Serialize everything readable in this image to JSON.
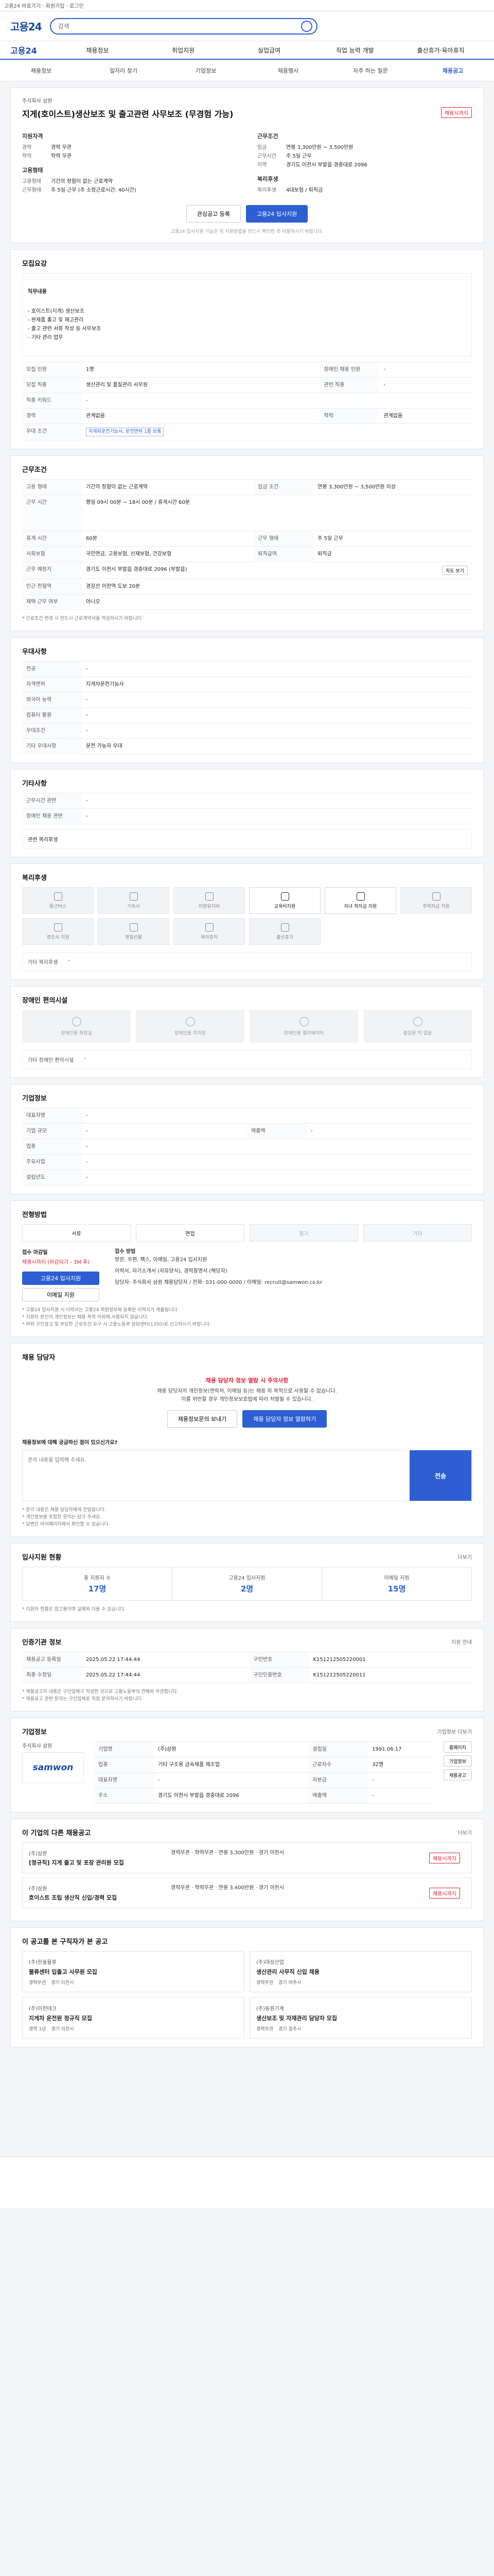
{
  "topbar": {
    "text": "고용24 바로가기 · 회원가입 · 로그인"
  },
  "header": {
    "logo": "고용24",
    "search_placeholder": "검색"
  },
  "gnb": {
    "logo": "고용24",
    "items": [
      "채용정보",
      "취업지원",
      "실업급여",
      "직업 능력 개발",
      "출산휴가·육아휴직"
    ]
  },
  "crumbs": [
    "채용정보",
    "일자리 찾기",
    "기업정보",
    "채용행사",
    "자주 하는 질문",
    "채용공고"
  ],
  "job": {
    "company": "주식회사 삼원",
    "title": "지게(호이스트)생산보조 및 출고관련 사무보조 (무경험 가능)",
    "badge": "채용시까지",
    "recruit_title": "지원자격",
    "career": "경력 무관",
    "education": "학력 무관",
    "cond_title": "근무조건",
    "pay": "연봉 3,300만원 ~ 3,500만원",
    "hours": "주 5일 근무",
    "location": "경기도 이천시 부발읍 경충대로 2096",
    "emp_title": "고용형태",
    "emp_type": "기간의 정함이 없는 근로계약",
    "work_type": "주 5일 근무 (주 소정근로시간: 40시간)",
    "welfare_title": "복리후생",
    "welfare_val": "4대보험 / 퇴직금",
    "btn_scrap": "관심공고 등록",
    "btn_apply": "고용24 입사지원",
    "notice": "고용24 입사지원 기능은 위 지원방법을 반드시 확인한 후 이용하시기 바랍니다."
  },
  "recruit": {
    "title": "모집요강",
    "duty_label": "직무내용",
    "duties": "- 호이스트(지게) 생산보조\n- 완제품 출고 및 재고관리\n- 출고 관련 서류 작성 등 사무보조\n- 기타 관리 업무",
    "rows": [
      {
        "k": "모집 인원",
        "v": "1명",
        "k2": "장애인 채용 인원",
        "v2": "-"
      },
      {
        "k": "모집 직종",
        "v": "생산관리 및 품질관리 사무원",
        "k2": "관련 직종",
        "v2": "-"
      },
      {
        "k": "직종 키워드",
        "v": "-",
        "k2": "",
        "v2": ""
      },
      {
        "k": "경력",
        "v": "관계없음",
        "k2": "학력",
        "v2": "관계없음"
      },
      {
        "k": "우대 조건",
        "v": "지게차운전기능사, 운전면허 1종 보통",
        "k2": "",
        "v2": ""
      }
    ]
  },
  "conditions": {
    "title": "근무조건",
    "rows": [
      {
        "k": "고용 형태",
        "v": "기간의 정함이 없는 근로계약",
        "k2": "임금 조건",
        "v2": "연봉 3,300만원 ~ 3,500만원 이상"
      },
      {
        "k": "근무 시간",
        "v": "평일 09시 00분 ~ 18시 00분 / 휴게시간 60분",
        "k2": "",
        "v2": ""
      },
      {
        "k": "휴게 시간",
        "v": "60분",
        "k2": "근무 형태",
        "v2": "주 5일 근무"
      },
      {
        "k": "사회보험",
        "v": "국민연금, 고용보험, 산재보험, 건강보험",
        "k2": "퇴직급여",
        "v2": "퇴직금"
      },
      {
        "k": "근무 예정지",
        "v": "경기도 이천시 부발읍 경충대로 2096 (부발읍)",
        "k2": "",
        "v2": ""
      },
      {
        "k": "인근 전철역",
        "v": "경강선 이천역 도보 20분",
        "k2": "",
        "v2": ""
      },
      {
        "k": "재택 근무 여부",
        "v": "아니오",
        "k2": "",
        "v2": ""
      }
    ],
    "map_btn": "지도 보기",
    "note": "* 근로조건 변경 시 반드시 근로계약서를 작성하시기 바랍니다."
  },
  "prefs": {
    "title": "우대사항",
    "rows": [
      {
        "k": "전공",
        "v": "-"
      },
      {
        "k": "자격면허",
        "v": "지게차운전기능사"
      },
      {
        "k": "외국어 능력",
        "v": "-"
      },
      {
        "k": "컴퓨터 활용",
        "v": "-"
      },
      {
        "k": "우대조건",
        "v": "-"
      },
      {
        "k": "기타 우대사항",
        "v": "운전 가능자 우대"
      }
    ]
  },
  "etc": {
    "title": "기타사항",
    "rows": [
      {
        "k": "근무시간 관련",
        "v": "-"
      },
      {
        "k": "장애인 채용 관련",
        "v": "-"
      }
    ],
    "link": "관련 복리후생"
  },
  "welfare": {
    "title": "복리후생",
    "items": [
      {
        "label": "통근버스",
        "on": false
      },
      {
        "label": "기숙사",
        "on": false
      },
      {
        "label": "차량유지비",
        "on": false
      },
      {
        "label": "교육비지원",
        "on": true
      },
      {
        "label": "자녀 학자금 지원",
        "on": true
      },
      {
        "label": "주택자금 지원",
        "on": false
      },
      {
        "label": "경조사 지원",
        "on": false
      },
      {
        "label": "명절선물",
        "on": false
      },
      {
        "label": "육아휴직",
        "on": false
      },
      {
        "label": "출산휴가",
        "on": false
      }
    ],
    "extra_label": "기타 복리후생",
    "extra_val": "-"
  },
  "disability": {
    "title": "장애인 편의시설",
    "items": [
      "장애인용 화장실",
      "장애인용 주차장",
      "장애인용 엘리베이터",
      "출입문 턱 없음"
    ],
    "extra_label": "기타 장애인 편의시설",
    "extra_val": "-"
  },
  "company_info": {
    "title": "기업정보",
    "rows": [
      {
        "k": "대표자명",
        "v": "-",
        "k2": "",
        "v2": ""
      },
      {
        "k": "기업 규모",
        "v": "-",
        "k2": "매출액",
        "v2": "-"
      },
      {
        "k": "업종",
        "v": "-",
        "k2": "",
        "v2": ""
      },
      {
        "k": "주요사업",
        "v": "-",
        "k2": "",
        "v2": ""
      },
      {
        "k": "설립년도",
        "v": "-",
        "k2": "",
        "v2": ""
      }
    ]
  },
  "apply": {
    "title": "전형방법",
    "methods": [
      {
        "label": "서류",
        "on": true
      },
      {
        "label": "면접",
        "on": true
      },
      {
        "label": "필기",
        "on": false
      },
      {
        "label": "기타",
        "on": false
      }
    ],
    "deadline_label": "접수 마감일",
    "deadline": "채용시까지 (마감되기 - 3M 후)",
    "how_label": "접수 방법",
    "how": "방문, 우편, 팩스, 이메일, 고용24 입사지원",
    "docs": "이력서, 자기소개서 (자유양식), 경력증명서 (해당자)",
    "contact": "담당자: 주식회사 삼원 채용담당자 / 전화: 031-000-0000 / 이메일: recruit@samwon.co.kr",
    "btn_apply": "고용24 입사지원",
    "btn_email": "이메일 지원",
    "notices": "* 고용24 입사지원 시 이력서는 고용24 회원정보에 등록된 이력서가 제출됩니다.\n* 지원자 본인의 개인정보는 채용 목적 이외에 사용되지 않습니다.\n* 허위 구인광고 및 부당한 근로조건 요구 시 고용노동부 상담센터(1350)로 신고하시기 바랍니다."
  },
  "safety": {
    "title": "채용 담당자",
    "warn": "채용 담당자 정보 열람 시 주의사항",
    "text": "채용 담당자의 개인정보(연락처, 이메일 등)는 채용 외 목적으로 사용할 수 없습니다.\n이를 위반할 경우 개인정보보호법에 따라 처벌될 수 있습니다.",
    "btn_a": "채용정보문의 보내기",
    "btn_b": "채용 담당자 정보 열람하기",
    "inq_label": "채용정보에 대해 궁금하신 점이 있으신가요?",
    "inq_placeholder": "문의 내용을 입력해 주세요.",
    "inq_send": "전송",
    "notes": "* 문의 내용은 채용 담당자에게 전달됩니다.\n* 개인정보를 포함한 문의는 삼가 주세요.\n* 답변은 마이페이지에서 확인할 수 있습니다."
  },
  "stats": {
    "title": "입사지원 현황",
    "link": "더보기",
    "items": [
      {
        "label": "총 지원자 수",
        "value": "17명"
      },
      {
        "label": "고용24 입사지원",
        "value": "2명"
      },
      {
        "label": "이메일 지원",
        "value": "15명"
      }
    ],
    "note": "* 지원자 현황은 참고용이며 실제와 다를 수 있습니다."
  },
  "history": {
    "title": "인증기관 정보",
    "link": "지원 안내",
    "rows": [
      {
        "k": "채용공고 등록일",
        "v": "2025.05.22 17:44:44",
        "k2": "구인번호",
        "v2": "K151212505220001"
      },
      {
        "k": "최종 수정일",
        "v": "2025.05.22 17:44:44",
        "k2": "구인인증번호",
        "v2": "K151212505220011"
      }
    ],
    "notes": "* 채용공고의 내용은 구인업체가 작성한 것으로 고용노동부의 견해와 무관합니다.\n* 채용공고 관련 문의는 구인업체로 직접 문의하시기 바랍니다."
  },
  "company": {
    "title": "기업정보",
    "link": "기업정보 더보기",
    "logo": "samwon",
    "name": "주식회사 삼원",
    "rows": [
      {
        "k": "기업명",
        "v": "(주)삼원",
        "k2": "설립일",
        "v2": "1991.06.17"
      },
      {
        "k": "업종",
        "v": "기타 구조용 금속제품 제조업",
        "k2": "근로자수",
        "v2": "32명"
      },
      {
        "k": "대표자명",
        "v": "-",
        "k2": "자본금",
        "v2": "-"
      },
      {
        "k": "주소",
        "v": "경기도 이천시 부발읍 경충대로 2096",
        "k2": "매출액",
        "v2": "-"
      }
    ],
    "btns": [
      "홈페이지",
      "기업정보",
      "채용공고"
    ]
  },
  "similar": {
    "title": "이 기업의 다른 채용공고",
    "link": "더보기",
    "items": [
      {
        "company": "(주)삼원",
        "title": "[정규직] 지게 출고 및 포장 관리원 모집",
        "meta": "경력무관 · 학력무관 · 연봉 3,300만원 · 경기 이천시",
        "badge": "채용시까지"
      },
      {
        "company": "(주)삼원",
        "title": "호이스트 조립 생산직 신입/경력 모집",
        "meta": "경력무관 · 학력무관 · 연봉 3,400만원 · 경기 이천시",
        "badge": "채용시까지"
      }
    ]
  },
  "recommend": {
    "title": "이 공고를 본 구직자가 본 공고",
    "items": [
      {
        "company": "(주)한솔물류",
        "title": "물류센터 입출고 사무원 모집",
        "meta1": "경력무관",
        "meta2": "경기 이천시"
      },
      {
        "company": "(주)대성산업",
        "title": "생산관리 사무직 신입 채용",
        "meta1": "경력무관",
        "meta2": "경기 여주시"
      },
      {
        "company": "(주)이천테크",
        "title": "지게차 운전원 정규직 모집",
        "meta1": "경력 1년",
        "meta2": "경기 이천시"
      },
      {
        "company": "(주)동원기계",
        "title": "생산보조 및 자재관리 담당자 모집",
        "meta1": "경력무관",
        "meta2": "경기 광주시"
      }
    ]
  }
}
